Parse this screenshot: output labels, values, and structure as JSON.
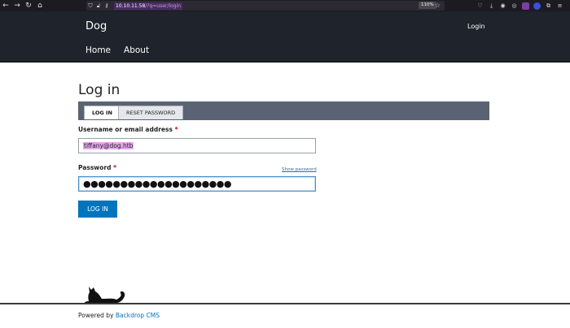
{
  "browser": {
    "url_host": "10.10.11.58",
    "url_path": "/?q=user/login",
    "zoom": "110%",
    "icons": [
      "back-icon",
      "forward-icon",
      "reload-icon",
      "home-icon",
      "shield-icon",
      "lock-icon",
      "key-icon",
      "star-icon",
      "pocket-icon",
      "download-icon",
      "account-icon",
      "extensions-icon",
      "menu-icon"
    ]
  },
  "site": {
    "name": "Dog",
    "login_link": "Login",
    "nav": [
      "Home",
      "About"
    ]
  },
  "page": {
    "title": "Log in",
    "tabs": [
      {
        "label": "LOG IN",
        "active": true
      },
      {
        "label": "RESET PASSWORD",
        "active": false
      }
    ]
  },
  "form": {
    "username_label": "Username or email address",
    "username_value": "tiffany@dog.htb",
    "password_label": "Password",
    "password_value": "●●●●●●●●●●●●●●●●●●●●",
    "show_password": "Show password",
    "required_mark": "*",
    "submit_label": "LOG IN"
  },
  "footer": {
    "powered_prefix": "Powered by",
    "powered_link": "Backdrop CMS"
  },
  "colors": {
    "header_bg": "#1f232b",
    "tabs_bg": "#5a6373",
    "button": "#0074bd",
    "highlight": "#e7a6f1",
    "required": "#d20000"
  }
}
